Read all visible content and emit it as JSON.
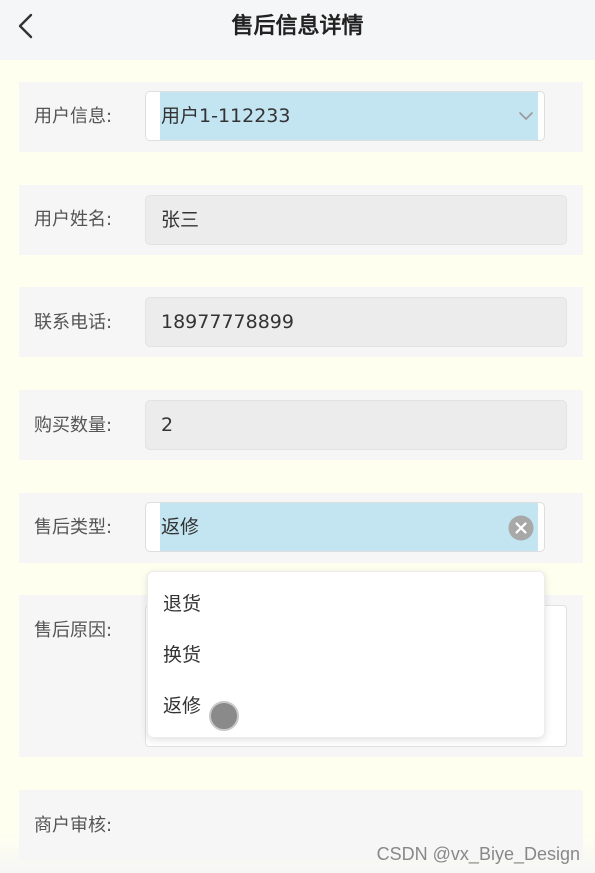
{
  "header": {
    "title": "售后信息详情",
    "back_icon": "chevron-left-icon"
  },
  "form": {
    "user_info": {
      "label": "用户信息:",
      "value": "用户1-112233",
      "icon": "chevron-down-icon"
    },
    "user_name": {
      "label": "用户姓名:",
      "value": "张三"
    },
    "phone": {
      "label": "联系电话:",
      "value": "18977778899"
    },
    "quantity": {
      "label": "购买数量:",
      "value": "2"
    },
    "aftersale_type": {
      "label": "售后类型:",
      "value": "返修",
      "icon": "clear-icon"
    },
    "aftersale_reason": {
      "label": "售后原因:",
      "value": ""
    },
    "merchant_review": {
      "label": "商户审核:"
    }
  },
  "dropdown": {
    "options": [
      "退货",
      "换货",
      "返修"
    ]
  },
  "watermark": "CSDN @vx_Biye_Design",
  "colors": {
    "page_background": "#fffff0",
    "select_highlight": "#c3e4f1",
    "row_background": "#f6f6f7"
  }
}
